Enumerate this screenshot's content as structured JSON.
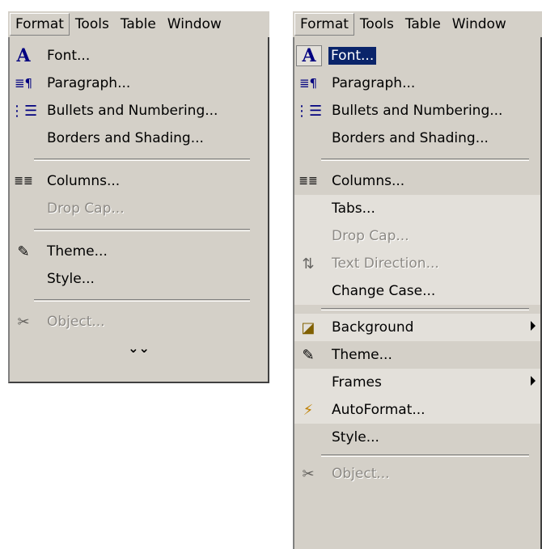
{
  "menubar": {
    "items": [
      "Format",
      "Tools",
      "Table",
      "Window"
    ]
  },
  "left_menu": {
    "items": [
      {
        "label": "Font...",
        "icon": "A",
        "enabled": true
      },
      {
        "label": "Paragraph...",
        "icon": "≣¶",
        "enabled": true
      },
      {
        "label": "Bullets and Numbering...",
        "icon": "⋮☰",
        "enabled": true
      },
      {
        "label": "Borders and Shading...",
        "icon": "",
        "enabled": true
      },
      {
        "label": "Columns...",
        "icon": "≣≣",
        "enabled": true
      },
      {
        "label": "Drop Cap...",
        "icon": "",
        "enabled": false
      },
      {
        "label": "Theme...",
        "icon": "✎",
        "enabled": true
      },
      {
        "label": "Style...",
        "icon": "",
        "enabled": true
      },
      {
        "label": "Object...",
        "icon": "✂",
        "enabled": false
      }
    ],
    "expand_glyph": "⌄⌄"
  },
  "right_menu": {
    "items": [
      {
        "label": "Font...",
        "icon": "A",
        "enabled": true
      },
      {
        "label": "Paragraph...",
        "icon": "≣¶",
        "enabled": true
      },
      {
        "label": "Bullets and Numbering...",
        "icon": "⋮☰",
        "enabled": true
      },
      {
        "label": "Borders and Shading...",
        "icon": "",
        "enabled": true
      },
      {
        "label": "Columns...",
        "icon": "≣≣",
        "enabled": true
      },
      {
        "label": "Tabs...",
        "icon": "",
        "enabled": true
      },
      {
        "label": "Drop Cap...",
        "icon": "",
        "enabled": false
      },
      {
        "label": "Text Direction...",
        "icon": "⇅",
        "enabled": false
      },
      {
        "label": "Change Case...",
        "icon": "",
        "enabled": true
      },
      {
        "label": "Background",
        "icon": "◪",
        "enabled": true
      },
      {
        "label": "Theme...",
        "icon": "✎",
        "enabled": true
      },
      {
        "label": "Frames",
        "icon": "",
        "enabled": true
      },
      {
        "label": "AutoFormat...",
        "icon": "⚡",
        "enabled": true
      },
      {
        "label": "Style...",
        "icon": "",
        "enabled": true
      },
      {
        "label": "Object...",
        "icon": "✂",
        "enabled": false
      }
    ]
  },
  "colors": {
    "menu_bg": "#d4d0c8",
    "highlight_bg": "#0a246a",
    "expanded_bg": "#e3e0da",
    "disabled_text": "#8d8a85"
  }
}
